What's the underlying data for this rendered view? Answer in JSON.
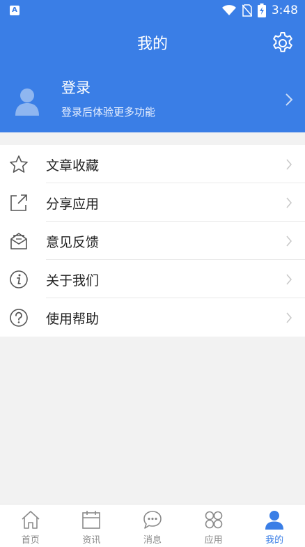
{
  "status_bar": {
    "app_badge": "A",
    "time": "3:48"
  },
  "header": {
    "title": "我的"
  },
  "profile": {
    "login_title": "登录",
    "login_subtitle": "登录后体验更多功能"
  },
  "menu": {
    "items": [
      {
        "label": "文章收藏",
        "icon": "star-icon"
      },
      {
        "label": "分享应用",
        "icon": "share-icon"
      },
      {
        "label": "意见反馈",
        "icon": "feedback-envelope-icon"
      },
      {
        "label": "关于我们",
        "icon": "info-icon"
      },
      {
        "label": "使用帮助",
        "icon": "help-icon"
      }
    ]
  },
  "tabbar": {
    "items": [
      {
        "label": "首页",
        "icon": "home-icon",
        "active": false
      },
      {
        "label": "资讯",
        "icon": "calendar-icon",
        "active": false
      },
      {
        "label": "消息",
        "icon": "chat-bubble-icon",
        "active": false
      },
      {
        "label": "应用",
        "icon": "apps-grid-icon",
        "active": false
      },
      {
        "label": "我的",
        "icon": "person-icon",
        "active": true
      }
    ]
  },
  "colors": {
    "primary": "#3a7ee6",
    "background": "#f2f2f2",
    "text": "#222222",
    "tab_inactive": "#8a8a8a"
  }
}
